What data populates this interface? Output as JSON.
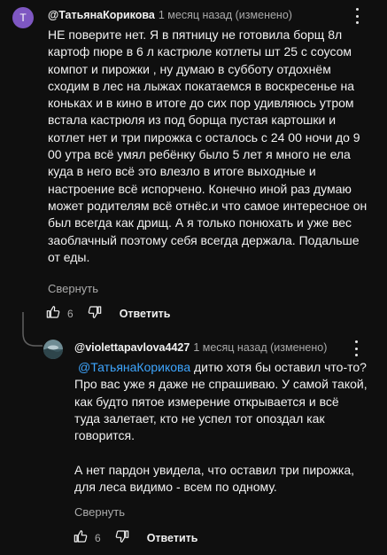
{
  "comment": {
    "avatar_letter": "T",
    "author": "@ТатьянаКорикова",
    "meta": "1 месяц назад (изменено)",
    "text": "НЕ поверите нет. Я в пятницу не готовила борщ 8л\nкартоф пюре в 6 л кастрюле котлеты шт 25 с соусом\nкомпот и пирожки , ну думаю в субботу отдохнём\nсходим в лес на лыжах покатаемся в воскресенье на\nконьках и в кино в итоге до сих пор удивляюсь утром\nвстала кастрюля из под борща  пустая картошки и\nкотлет нет и три пирожка с осталось  с 24 00 ночи до 9\n00 утра всё умял  ребёнку было 5 лет я много не ела\nкуда в него всё это влезло в итоге  выходные и\nнастроение всё испорчено. Конечно иной раз думаю\nможет родителям всё отнёс.и что самое интересное он\nбыл всегда как дрищ. А я только понюхать и уже вес\nзаоблачный поэтому себя всегда держала. Подальше\nот еды.",
    "collapse_label": "Свернуть",
    "like_count": "6",
    "reply_label": "Ответить"
  },
  "reply": {
    "author": "@violettapavlova4427",
    "meta": "1 месяц назад (изменено)",
    "mention": "@ТатьянаКорикова",
    "text": "дитю хотя бы оставил что-то?\nПро вас уже я даже не спрашиваю. У самой такой,\nкак будто пятое измерение открывается и всё\nтуда залетает, кто не успел тот опоздал как\nговорится.\n\nА нет пардон увидела, что оставил три пирожка,\nдля леса видимо - всем по одному.",
    "collapse_label": "Свернуть",
    "like_count": "6",
    "reply_label": "Ответить"
  },
  "colors": {
    "background": "#0f0f0f",
    "text": "#f1f1f1",
    "secondary": "#aaaaaa",
    "mention": "#3ea6ff",
    "avatar": "#7e57c2"
  },
  "icons": [
    "more-vert-icon",
    "thumb-up-icon",
    "thumb-down-icon",
    "reply-arrow-icon"
  ]
}
